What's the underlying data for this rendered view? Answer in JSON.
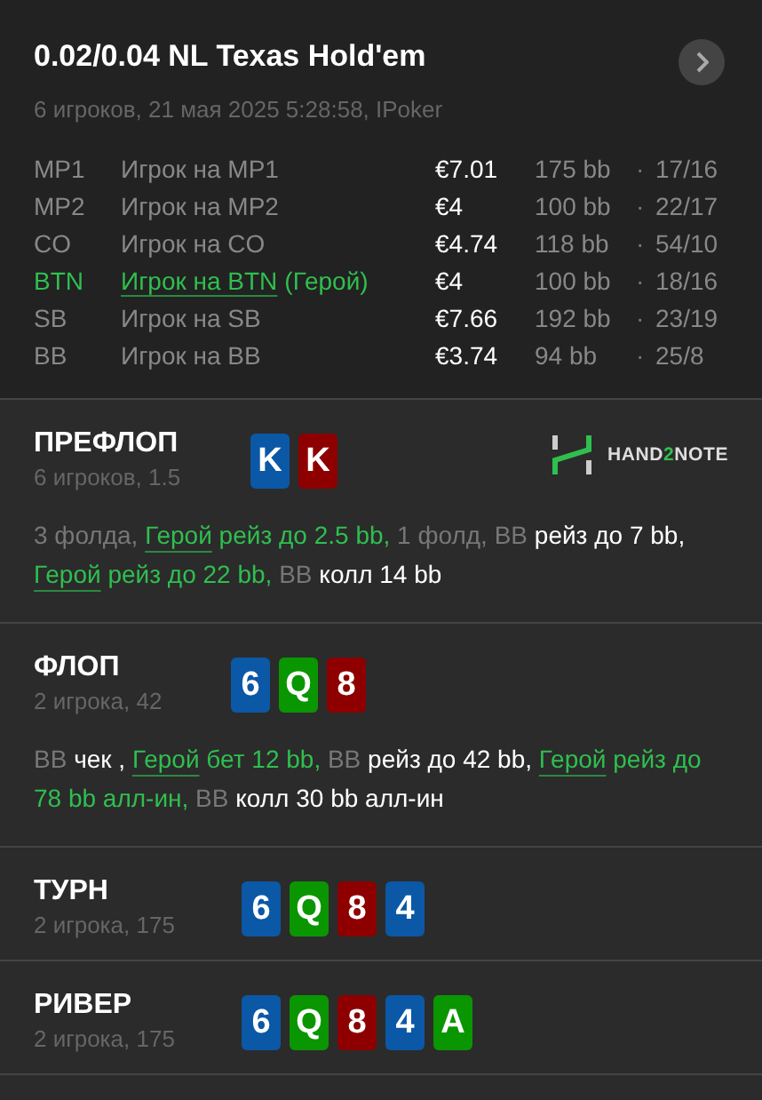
{
  "header": {
    "title": "0.02/0.04 NL Texas Hold'em",
    "subtitle": "6 игроков, 21 мая 2025 5:28:58, IPoker"
  },
  "players": [
    {
      "position": "MP1",
      "name": "Игрок на MP1",
      "hero": false,
      "stack": "€7.01",
      "bb": "175 bb",
      "separator": "·",
      "stats": "17/16"
    },
    {
      "position": "MP2",
      "name": "Игрок на MP2",
      "hero": false,
      "stack": "€4",
      "bb": "100 bb",
      "separator": "·",
      "stats": "22/17"
    },
    {
      "position": "CO",
      "name": "Игрок на CO",
      "hero": false,
      "stack": "€4.74",
      "bb": "118 bb",
      "separator": "·",
      "stats": "54/10"
    },
    {
      "position": "BTN",
      "name": "Игрок на BTN",
      "hero": true,
      "hero_label": "(Герой)",
      "stack": "€4",
      "bb": "100 bb",
      "separator": "·",
      "stats": "18/16"
    },
    {
      "position": "SB",
      "name": "Игрок на SB",
      "hero": false,
      "stack": "€7.66",
      "bb": "192 bb",
      "separator": "·",
      "stats": "23/19"
    },
    {
      "position": "BB",
      "name": "Игрок на BB",
      "hero": false,
      "stack": "€3.74",
      "bb": "94 bb",
      "separator": "·",
      "stats": "25/8"
    }
  ],
  "streets": [
    {
      "title": "ПРЕФЛОП",
      "info": "6 игроков, 1.5",
      "logo": {
        "before": "HAND",
        "accent": "2",
        "after": "NOTE"
      },
      "cards": [
        {
          "rank": "K",
          "color": "#0b58a6"
        },
        {
          "rank": "K",
          "color": "#8e0000"
        }
      ],
      "actions": [
        {
          "kind": "muted",
          "text": "3 фолда, "
        },
        {
          "kind": "hero",
          "text": "Герой"
        },
        {
          "kind": "hero_action",
          "text": " рейз до 2.5 bb, "
        },
        {
          "kind": "muted",
          "text": "1 фолд, BB "
        },
        {
          "kind": "action",
          "text": "рейз до 7 bb, "
        },
        {
          "kind": "hero",
          "text": "Герой"
        },
        {
          "kind": "hero_action",
          "text": " рейз до 22 bb, "
        },
        {
          "kind": "muted",
          "text": "BB "
        },
        {
          "kind": "action",
          "text": "колл 14 bb"
        }
      ]
    },
    {
      "title": "ФЛОП",
      "info": "2 игрока, 42",
      "cards": [
        {
          "rank": "6",
          "color": "#0b58a6"
        },
        {
          "rank": "Q",
          "color": "#0a9600"
        },
        {
          "rank": "8",
          "color": "#8e0000"
        }
      ],
      "actions": [
        {
          "kind": "muted",
          "text": "BB "
        },
        {
          "kind": "action",
          "text": "чек , "
        },
        {
          "kind": "hero",
          "text": "Герой"
        },
        {
          "kind": "hero_action",
          "text": " бет 12 bb, "
        },
        {
          "kind": "muted",
          "text": "BB "
        },
        {
          "kind": "action",
          "text": "рейз до 42 bb, "
        },
        {
          "kind": "hero",
          "text": "Герой"
        },
        {
          "kind": "hero_action",
          "text": " рейз до 78 bb алл-ин, "
        },
        {
          "kind": "muted",
          "text": "BB "
        },
        {
          "kind": "action",
          "text": "колл 30 bb алл-ин"
        }
      ]
    },
    {
      "title": "ТУРН",
      "info": "2 игрока, 175",
      "cards": [
        {
          "rank": "6",
          "color": "#0b58a6"
        },
        {
          "rank": "Q",
          "color": "#0a9600"
        },
        {
          "rank": "8",
          "color": "#8e0000"
        },
        {
          "rank": "4",
          "color": "#0b58a6"
        }
      ]
    },
    {
      "title": "РИВЕР",
      "info": "2 игрока, 175",
      "cards": [
        {
          "rank": "6",
          "color": "#0b58a6"
        },
        {
          "rank": "Q",
          "color": "#0a9600"
        },
        {
          "rank": "8",
          "color": "#8e0000"
        },
        {
          "rank": "4",
          "color": "#0b58a6"
        },
        {
          "rank": "A",
          "color": "#0a9600"
        }
      ]
    }
  ]
}
